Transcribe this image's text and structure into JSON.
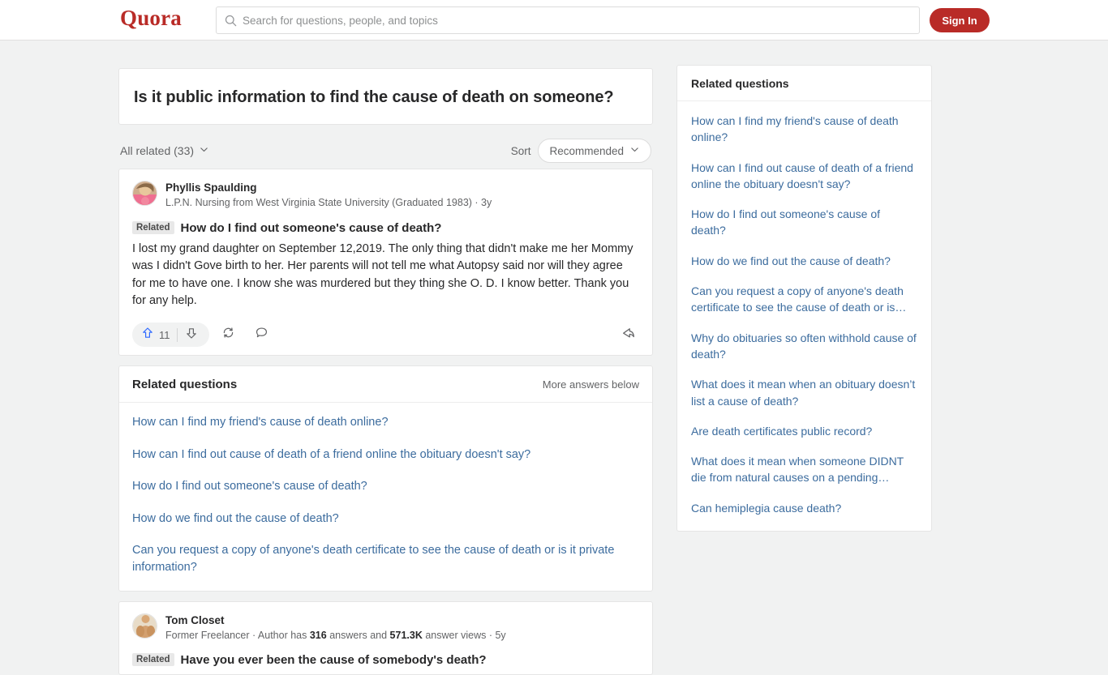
{
  "header": {
    "logo": "Quora",
    "search_placeholder": "Search for questions, people, and topics",
    "search_value": "",
    "signin_label": "Sign In"
  },
  "question": {
    "title": "Is it public information to find the cause of death on someone?"
  },
  "filters": {
    "all_related_label": "All related (33)",
    "sort_label": "Sort",
    "sort_value": "Recommended"
  },
  "answers": [
    {
      "author": "Phyllis Spaulding",
      "credential": "L.P.N. Nursing from West Virginia State University (Graduated 1983) · 3y",
      "related_badge": "Related",
      "related_question": "How do I find out someone's cause of death?",
      "body": "I lost my grand daughter on September 12,2019. The only thing that didn't make me her Mommy was I didn't Gove birth to her. Her parents will not tell me what Autopsy said nor will they agree for me to have one. I know she was murdered but they thing she O. D. I know better. Thank you for any help.",
      "upvote_count": "11"
    },
    {
      "author": "Tom Closet",
      "credential_pre": "Former Freelancer · Author has ",
      "credential_answers": "316",
      "credential_mid": " answers and ",
      "credential_views": "571.3K",
      "credential_post": " answer views · 5y",
      "related_badge": "Related",
      "related_question": "Have you ever been the cause of somebody's death?"
    }
  ],
  "related_questions_main": {
    "title": "Related questions",
    "more_label": "More answers below",
    "items": [
      "How can I find my friend's cause of death online?",
      "How can I find out cause of death of a friend online the obituary doesn't say?",
      "How do I find out someone's cause of death?",
      "How do we find out the cause of death?",
      "Can you request a copy of anyone's death certificate to see the cause of death or is it private information?"
    ]
  },
  "related_questions_sidebar": {
    "title": "Related questions",
    "items": [
      "How can I find my friend's cause of death online?",
      "How can I find out cause of death of a friend online the obituary doesn't say?",
      "How do I find out someone's cause of death?",
      "How do we find out the cause of death?",
      "Can you request a copy of anyone's death certificate to see the cause of death or is…",
      "Why do obituaries so often withhold cause of death?",
      "What does it mean when an obituary doesn’t list a cause of death?",
      "Are death certificates public record?",
      "What does it mean when someone DIDNT die from natural causes on a pending…",
      "Can hemiplegia cause death?"
    ]
  },
  "colors": {
    "brand_red": "#b92b27",
    "link_blue": "#3c6c9e",
    "upvote_blue": "#2e69ff",
    "page_bg": "#f1f2f2"
  }
}
